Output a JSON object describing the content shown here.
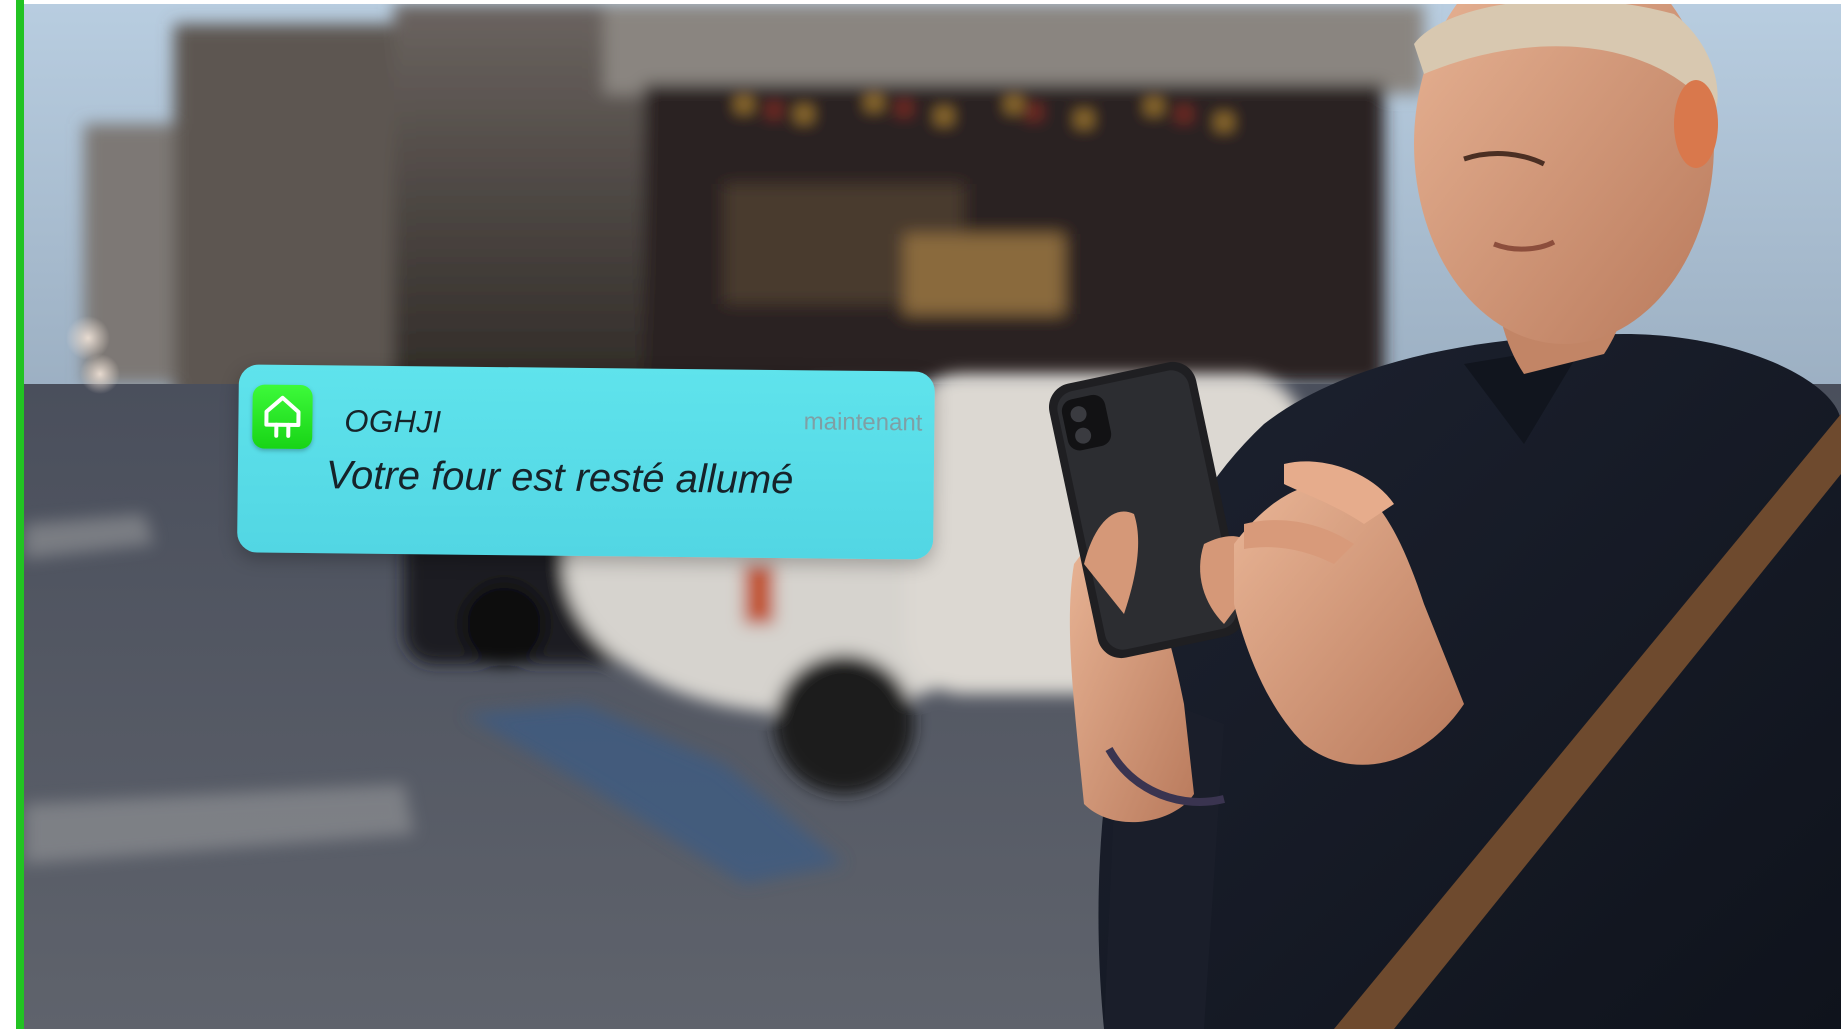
{
  "notification": {
    "app_name": "OGHJI",
    "timestamp": "maintenant",
    "message": "Votre four est resté allumé",
    "icon": "smart-plug-home-icon"
  },
  "colors": {
    "frame_edge": "#22c322",
    "notification_bg": "#5fe3ec",
    "app_icon_bg": "#2ee82b"
  }
}
